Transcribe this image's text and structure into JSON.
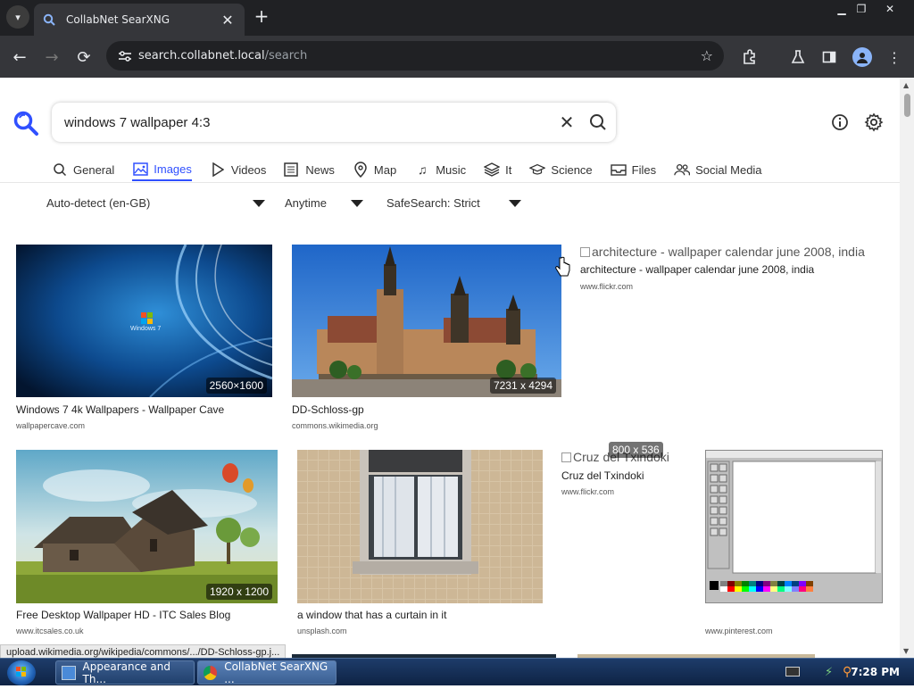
{
  "browser": {
    "tab_title": "CollabNet SearXNG",
    "url_host": "search.collabnet.local",
    "url_path": "/search"
  },
  "search": {
    "query": "windows 7 wallpaper 4:3"
  },
  "categories": [
    {
      "label": "General",
      "icon": "search-icon"
    },
    {
      "label": "Images",
      "icon": "image-icon",
      "active": true
    },
    {
      "label": "Videos",
      "icon": "play-icon"
    },
    {
      "label": "News",
      "icon": "newspaper-icon"
    },
    {
      "label": "Map",
      "icon": "map-pin-icon"
    },
    {
      "label": "Music",
      "icon": "music-note-icon"
    },
    {
      "label": "It",
      "icon": "layers-icon"
    },
    {
      "label": "Science",
      "icon": "graduation-cap-icon"
    },
    {
      "label": "Files",
      "icon": "inbox-icon"
    },
    {
      "label": "Social Media",
      "icon": "people-icon"
    }
  ],
  "filters": {
    "language": "Auto-detect (en-GB)",
    "time": "Anytime",
    "safesearch": "SafeSearch: Strict"
  },
  "results": [
    {
      "title": "Windows 7 4k Wallpapers - Wallpaper Cave",
      "source": "wallpapercave.com",
      "dimensions": "2560×1600"
    },
    {
      "title": "DD-Schloss-gp",
      "source": "commons.wikimedia.org",
      "dimensions": "7231 x 4294"
    },
    {
      "title": "architecture - wallpaper calendar june 2008, india",
      "alt": "architecture - wallpaper calendar june 2008, india",
      "source": "www.flickr.com"
    },
    {
      "title": "Free Desktop Wallpaper HD - ITC Sales Blog",
      "source": "www.itcsales.co.uk",
      "dimensions": "1920 x 1200"
    },
    {
      "title": "a window that has a curtain in it",
      "source": "unsplash.com"
    },
    {
      "title": "Cruz del Txindoki",
      "alt": "Cruz del Txindoki",
      "source": "www.flickr.com",
      "dimensions": "800 x 536"
    },
    {
      "title": "",
      "source": "www.pinterest.com"
    }
  ],
  "status_url": "upload.wikimedia.org/wikipedia/commons/.../DD-Schloss-gp.j...",
  "taskbar": {
    "tasks": [
      "Appearance and Th...",
      "CollabNet SearXNG ..."
    ],
    "clock": "7:28 PM"
  },
  "colors": {
    "accent": "#3050ff",
    "chrome_dark": "#202124"
  }
}
